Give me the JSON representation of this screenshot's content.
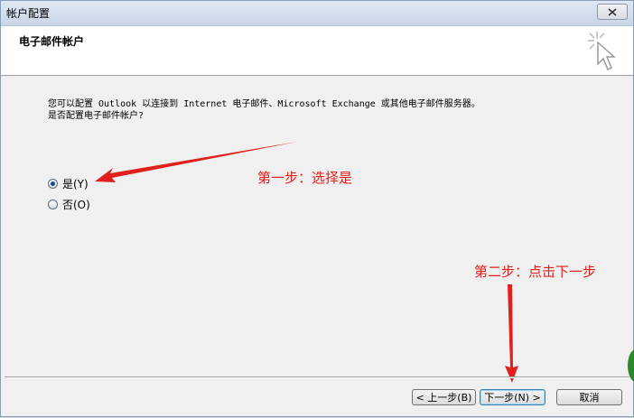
{
  "window": {
    "title": "帐户配置"
  },
  "header": {
    "title": "电子邮件帐户"
  },
  "intro": {
    "line1": "您可以配置 Outlook 以连接到 Internet 电子邮件、Microsoft Exchange 或其他电子邮件服务器。",
    "line2": "是否配置电子邮件帐户?"
  },
  "options": [
    {
      "label": "是(Y)",
      "checked": true
    },
    {
      "label": "否(O)",
      "checked": false
    }
  ],
  "annotations": {
    "step1": "第一步：选择是",
    "step2": "第二步：点击下一步",
    "color": "#e0201c"
  },
  "buttons": {
    "back": "< 上一步(B)",
    "next": "下一步(N) >",
    "cancel": "取消"
  }
}
